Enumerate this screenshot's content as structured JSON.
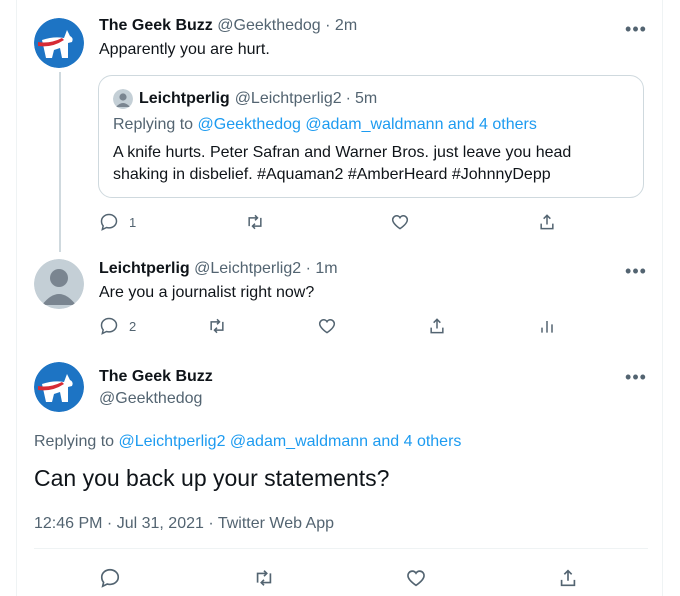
{
  "colors": {
    "link": "#1d9bf0",
    "muted": "#536471",
    "text": "#0f1419",
    "border": "#cfd9de"
  },
  "tweet1": {
    "name": "The Geek Buzz",
    "handle": "@Geekthedog",
    "sep": "·",
    "time": "2m",
    "text": "Apparently you are hurt.",
    "more": "•••",
    "quote": {
      "name": "Leichtperlig",
      "handle": "@Leichtperlig2",
      "sep": "·",
      "time": "5m",
      "replying_prefix": "Replying to",
      "replying_to": "@Geekthedog @adam_waldmann and 4 others",
      "text_line1": "A knife hurts. Peter Safran and Warner Bros. just leave you head",
      "text_line2": "shaking in disbelief. #Aquaman2 #AmberHeard #JohnnyDepp"
    },
    "reply_count": "1",
    "icons": [
      "reply-icon",
      "retweet-icon",
      "like-icon",
      "share-icon"
    ]
  },
  "tweet2": {
    "name": "Leichtperlig",
    "handle": "@Leichtperlig2",
    "sep": "·",
    "time": "1m",
    "text": "Are you a journalist right now?",
    "more": "•••",
    "reply_count": "2",
    "icons": [
      "reply-icon",
      "retweet-icon",
      "like-icon",
      "share-icon",
      "analytics-icon"
    ]
  },
  "tweet3": {
    "name": "The Geek Buzz",
    "handle": "@Geekthedog",
    "more": "•••",
    "replying_prefix": "Replying to",
    "replying_to": "@Leichtperlig2 @adam_waldmann and 4 others",
    "text": "Can you back up your statements?",
    "timestamp": "12:46 PM · Jul 31, 2021 · Twitter Web App",
    "icons": [
      "reply-icon",
      "retweet-icon",
      "like-icon",
      "share-icon"
    ]
  }
}
